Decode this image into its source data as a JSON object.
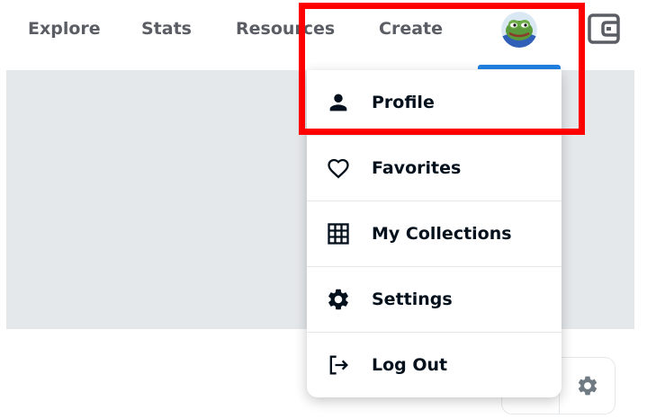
{
  "nav": {
    "links": [
      "Explore",
      "Stats",
      "Resources",
      "Create"
    ],
    "active_color": "#2081e2",
    "avatar_icon": "frog-avatar-icon",
    "wallet_icon": "wallet-icon"
  },
  "profile_menu": {
    "items": [
      {
        "label": "Profile",
        "icon": "person-icon"
      },
      {
        "label": "Favorites",
        "icon": "heart-icon"
      },
      {
        "label": "My Collections",
        "icon": "grid-icon"
      },
      {
        "label": "Settings",
        "icon": "gear-icon"
      },
      {
        "label": "Log Out",
        "icon": "logout-icon"
      }
    ]
  },
  "toolbar": {
    "settings_icon": "gear-icon"
  },
  "annotation": {
    "color": "#ff0000",
    "target": "Profile"
  }
}
